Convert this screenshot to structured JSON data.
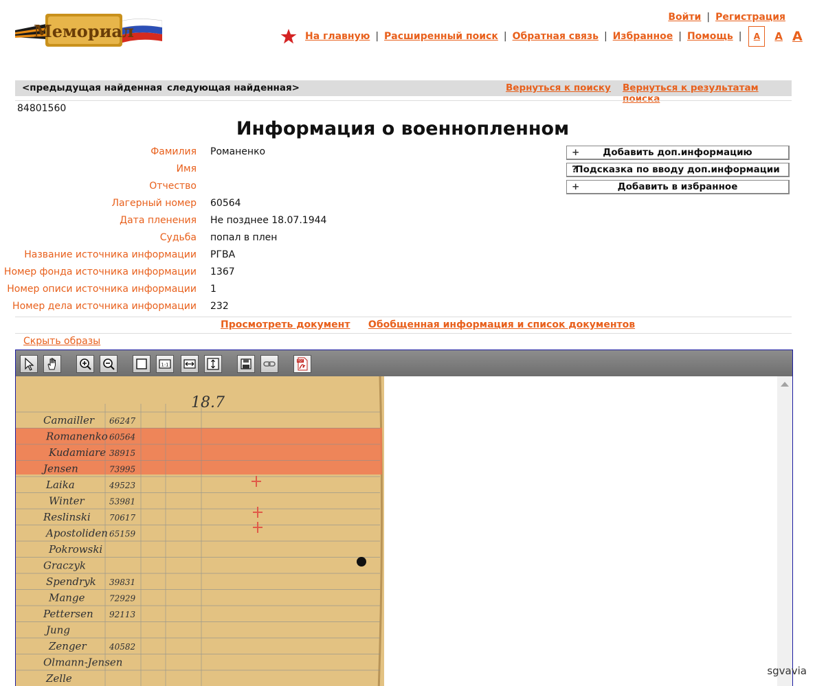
{
  "header": {
    "logo_text": "Мемориал",
    "login": "Войти",
    "register": "Регистрация",
    "nav": [
      "На главную",
      "Расширенный поиск",
      "Обратная связь",
      "Избранное",
      "Помощь"
    ],
    "font_sizes": [
      "A",
      "A",
      "A"
    ]
  },
  "resultbar": {
    "prev": "<предыдущая найденная",
    "next": "следующая найденная>",
    "back_to_search": "Вернуться к поиску",
    "back_to_results": "Вернуться к результатам поиска"
  },
  "record_id": "84801560",
  "title": "Информация о военнопленном",
  "fields": [
    {
      "label": "Фамилия",
      "value": "Романенко"
    },
    {
      "label": "Имя",
      "value": ""
    },
    {
      "label": "Отчество",
      "value": ""
    },
    {
      "label": "Лагерный номер",
      "value": "60564"
    },
    {
      "label": "Дата пленения",
      "value": "Не позднее 18.07.1944"
    },
    {
      "label": "Судьба",
      "value": "попал в плен"
    },
    {
      "label": "Название источника информации",
      "value": "РГВА"
    },
    {
      "label": "Номер фонда источника информации",
      "value": "1367"
    },
    {
      "label": "Номер описи источника информации",
      "value": "1"
    },
    {
      "label": "Номер дела источника информации",
      "value": "232"
    }
  ],
  "side_buttons": [
    {
      "icon": "+",
      "label": "Добавить доп.информацию"
    },
    {
      "icon": "?",
      "label": "Подсказка по вводу доп.информации"
    },
    {
      "icon": "+",
      "label": "Добавить в избранное"
    }
  ],
  "doc_links": {
    "view": "Просмотреть документ",
    "summary": "Обобщенная информация и список документов"
  },
  "hide_images": "Скрыть образы",
  "toolbar_icons": [
    "pointer-icon",
    "hand-icon",
    "zoom-in-icon",
    "zoom-out-icon",
    "fit-page-icon",
    "actual-size-icon",
    "fit-width-icon",
    "fit-height-icon",
    "save-icon",
    "link-icon",
    "pdf-icon"
  ],
  "document": {
    "date_heading": "18.7",
    "rows": [
      {
        "name": "Camailler",
        "num": "66247"
      },
      {
        "name": "Romanenko",
        "num": "60564"
      },
      {
        "name": "Kudamiare",
        "num": "38915"
      },
      {
        "name": "Jensen",
        "num": "73995"
      },
      {
        "name": "Laika",
        "num": "49523"
      },
      {
        "name": "Winter",
        "num": "53981"
      },
      {
        "name": "Reslinski",
        "num": "70617"
      },
      {
        "name": "Apostoliden",
        "num": "65159"
      },
      {
        "name": "Pokrowski",
        "num": ""
      },
      {
        "name": "Graczyk",
        "num": ""
      },
      {
        "name": "Spendryk",
        "num": "39831"
      },
      {
        "name": "Mange",
        "num": "72929"
      },
      {
        "name": "Pettersen",
        "num": "92113"
      },
      {
        "name": "Jung",
        "num": ""
      },
      {
        "name": "Zenger",
        "num": "40582"
      },
      {
        "name": "Olmann-Jensen",
        "num": ""
      },
      {
        "name": "Zelle",
        "num": ""
      }
    ]
  },
  "watermark": "sgvavia",
  "colors": {
    "accent": "#e8601c",
    "bar": "#dcdcdc",
    "highlight": "#f07850",
    "viewer_border": "#1a1aa0"
  }
}
